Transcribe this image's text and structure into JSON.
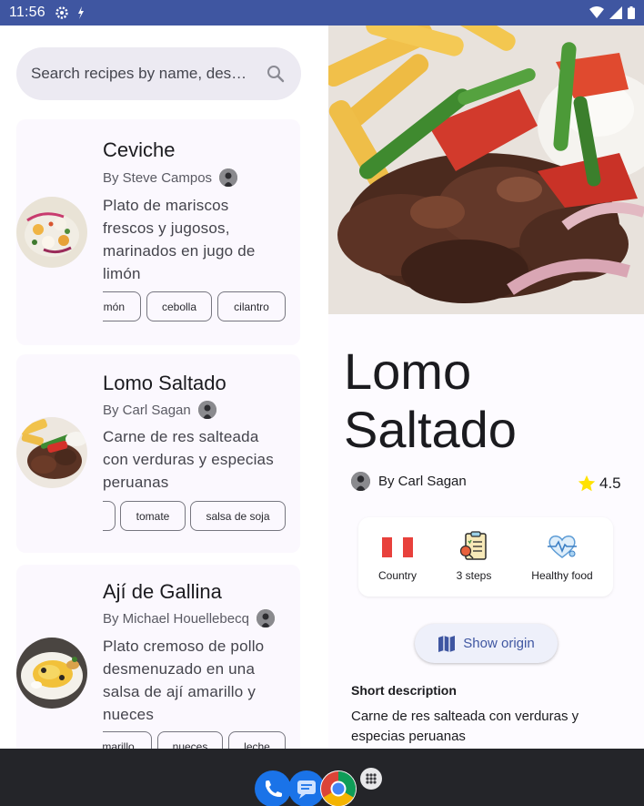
{
  "status_bar": {
    "time": "11:56"
  },
  "search": {
    "placeholder": "Search recipes by name, des…"
  },
  "recipes": [
    {
      "title": "Ceviche",
      "author": "By Steve Campos",
      "description": "Plato de mariscos frescos y jugosos, marinados en jugo de limón",
      "chips": [
        "imón",
        "cebolla",
        "cilantro"
      ]
    },
    {
      "title": "Lomo Saltado",
      "author": "By Carl Sagan",
      "description": "Carne de res salteada con verduras y especias peruanas",
      "chips": [
        "",
        "tomate",
        "salsa de soja"
      ]
    },
    {
      "title": "Ají de Gallina",
      "author": "By Michael Houellebecq",
      "description": "Plato cremoso de pollo desmenuzado en una salsa de ají amarillo y nueces",
      "chips": [
        "marillo",
        "nueces",
        "leche"
      ]
    }
  ],
  "detail": {
    "title_line1": "Lomo",
    "title_line2": "Saltado",
    "author": "By Carl Sagan",
    "rating": "4.5",
    "info": [
      {
        "label": "Country",
        "icon": "peru-flag-icon"
      },
      {
        "label": "3 steps",
        "icon": "recipe-steps-icon"
      },
      {
        "label": "Healthy food",
        "icon": "healthy-heart-icon"
      }
    ],
    "show_origin_label": "Show origin",
    "short_description_title": "Short description",
    "short_description": "Carne de res salteada con verduras y especias peruanas"
  },
  "colors": {
    "status_bar": "#3f56a1",
    "accent": "#3f56a1",
    "star": "#ffe200",
    "flag_red": "#e8413c",
    "nav_bar": "#242529"
  }
}
